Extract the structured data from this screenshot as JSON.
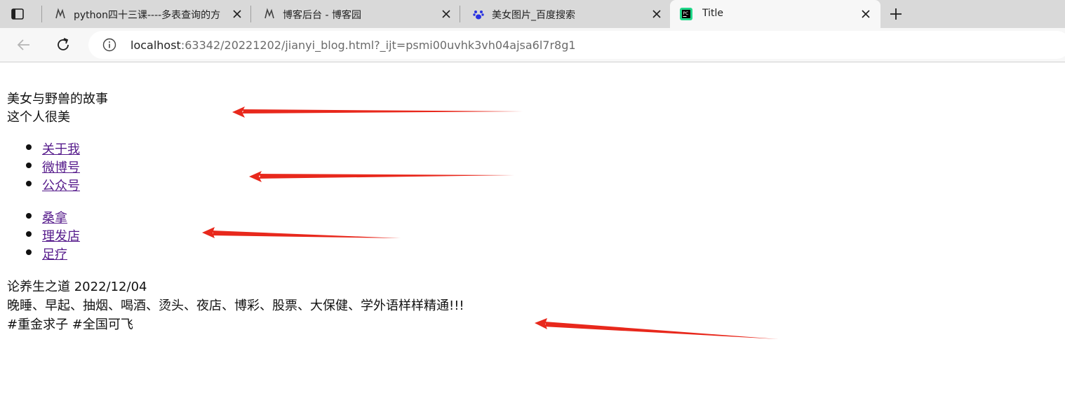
{
  "browser": {
    "tabs": [
      {
        "title": "python四十三课----多表查询的方",
        "icon": "cnblogs-icon"
      },
      {
        "title": "博客后台 - 博客园",
        "icon": "cnblogs-icon"
      },
      {
        "title": "美女图片_百度搜索",
        "icon": "baidu-paw-icon"
      },
      {
        "title": "Title",
        "icon": "pycharm-icon"
      }
    ],
    "url_host": "localhost",
    "url_rest": ":63342/20221202/jianyi_blog.html?_ijt=psmi00uvhk3vh04ajsa6l7r8g1"
  },
  "page": {
    "title": "美女与野兽的故事",
    "subtitle": "这个人很美",
    "menu1": [
      "关于我",
      "微博号",
      "公众号"
    ],
    "menu2": [
      "桑拿",
      "理发店",
      "足疗"
    ],
    "article": {
      "heading": "论养生之道 2022/12/04",
      "body": "晚睡、早起、抽烟、喝酒、烫头、夜店、博彩、股票、大保健、学外语样样精通!!!",
      "tags": "#重金求子 #全国可飞"
    }
  },
  "colors": {
    "arrow": "#e8281c",
    "visited_link": "#551a8b",
    "tabstrip": "#d9d9d9",
    "active_tab": "#f7f7f7"
  }
}
